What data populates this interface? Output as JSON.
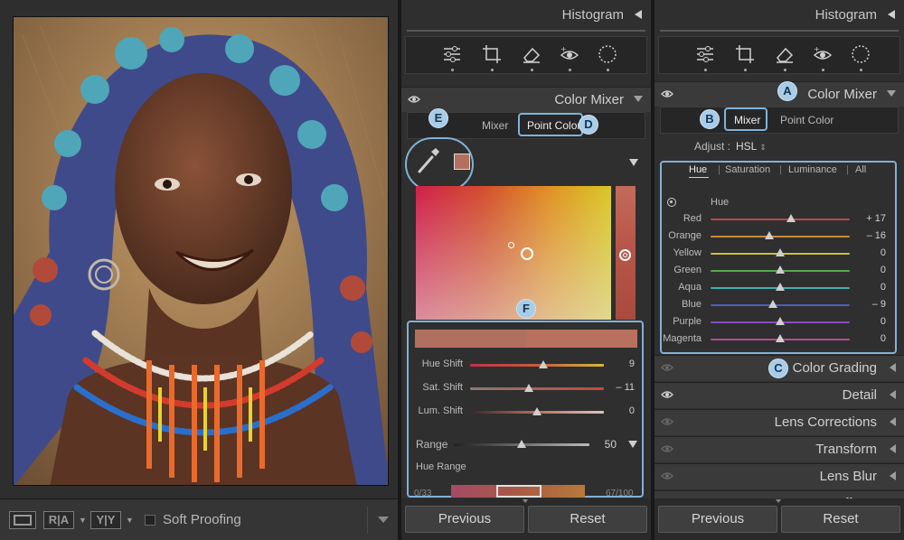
{
  "left": {
    "toolbar": {
      "compare_ra": "R|A",
      "compare_yy": "Y|Y",
      "soft_proofing_label": "Soft Proofing"
    }
  },
  "panel_mid": {
    "histogram_title": "Histogram",
    "color_mixer_title": "Color Mixer",
    "tabs": {
      "mixer": "Mixer",
      "point_color": "Point Color"
    },
    "sliders": [
      {
        "label": "Hue Shift",
        "value": "9",
        "fraction": 0.55
      },
      {
        "label": "Sat. Shift",
        "value": "– 11",
        "fraction": 0.44
      },
      {
        "label": "Lum. Shift",
        "value": "0",
        "fraction": 0.5
      }
    ],
    "range": {
      "label": "Range",
      "value": "50",
      "fraction": 0.5
    },
    "hue_range_label": "Hue Range",
    "hue_range_left": "0/33",
    "hue_range_right": "67/100",
    "buttons": {
      "previous": "Previous",
      "reset": "Reset"
    },
    "markers": {
      "D": "D",
      "E": "E",
      "F": "F"
    }
  },
  "panel_right": {
    "histogram_title": "Histogram",
    "color_mixer_title": "Color Mixer",
    "tabs": {
      "mixer": "Mixer",
      "point_color": "Point Color"
    },
    "adjust_label": "Adjust :",
    "adjust_value": "HSL",
    "hsl_tabs": {
      "hue": "Hue",
      "saturation": "Saturation",
      "luminance": "Luminance",
      "all": "All"
    },
    "hue_group_label": "Hue",
    "hue_sliders": [
      {
        "label": "Red",
        "value": "+ 17",
        "fraction": 0.58,
        "color": "#b44a52"
      },
      {
        "label": "Orange",
        "value": "– 16",
        "fraction": 0.42,
        "color": "#c98a3a"
      },
      {
        "label": "Yellow",
        "value": "0",
        "fraction": 0.5,
        "color": "#c8c044"
      },
      {
        "label": "Green",
        "value": "0",
        "fraction": 0.5,
        "color": "#56a94e"
      },
      {
        "label": "Aqua",
        "value": "0",
        "fraction": 0.5,
        "color": "#45aeb0"
      },
      {
        "label": "Blue",
        "value": "– 9",
        "fraction": 0.45,
        "color": "#4c5fc2"
      },
      {
        "label": "Purple",
        "value": "0",
        "fraction": 0.5,
        "color": "#8a4bbd"
      },
      {
        "label": "Magenta",
        "value": "0",
        "fraction": 0.5,
        "color": "#b34a9f"
      }
    ],
    "sections": [
      "Color Grading",
      "Detail",
      "Lens Corrections",
      "Transform",
      "Lens Blur",
      "Effects"
    ],
    "buttons": {
      "previous": "Previous",
      "reset": "Reset"
    },
    "markers": {
      "A": "A",
      "B": "B",
      "C": "C"
    }
  }
}
